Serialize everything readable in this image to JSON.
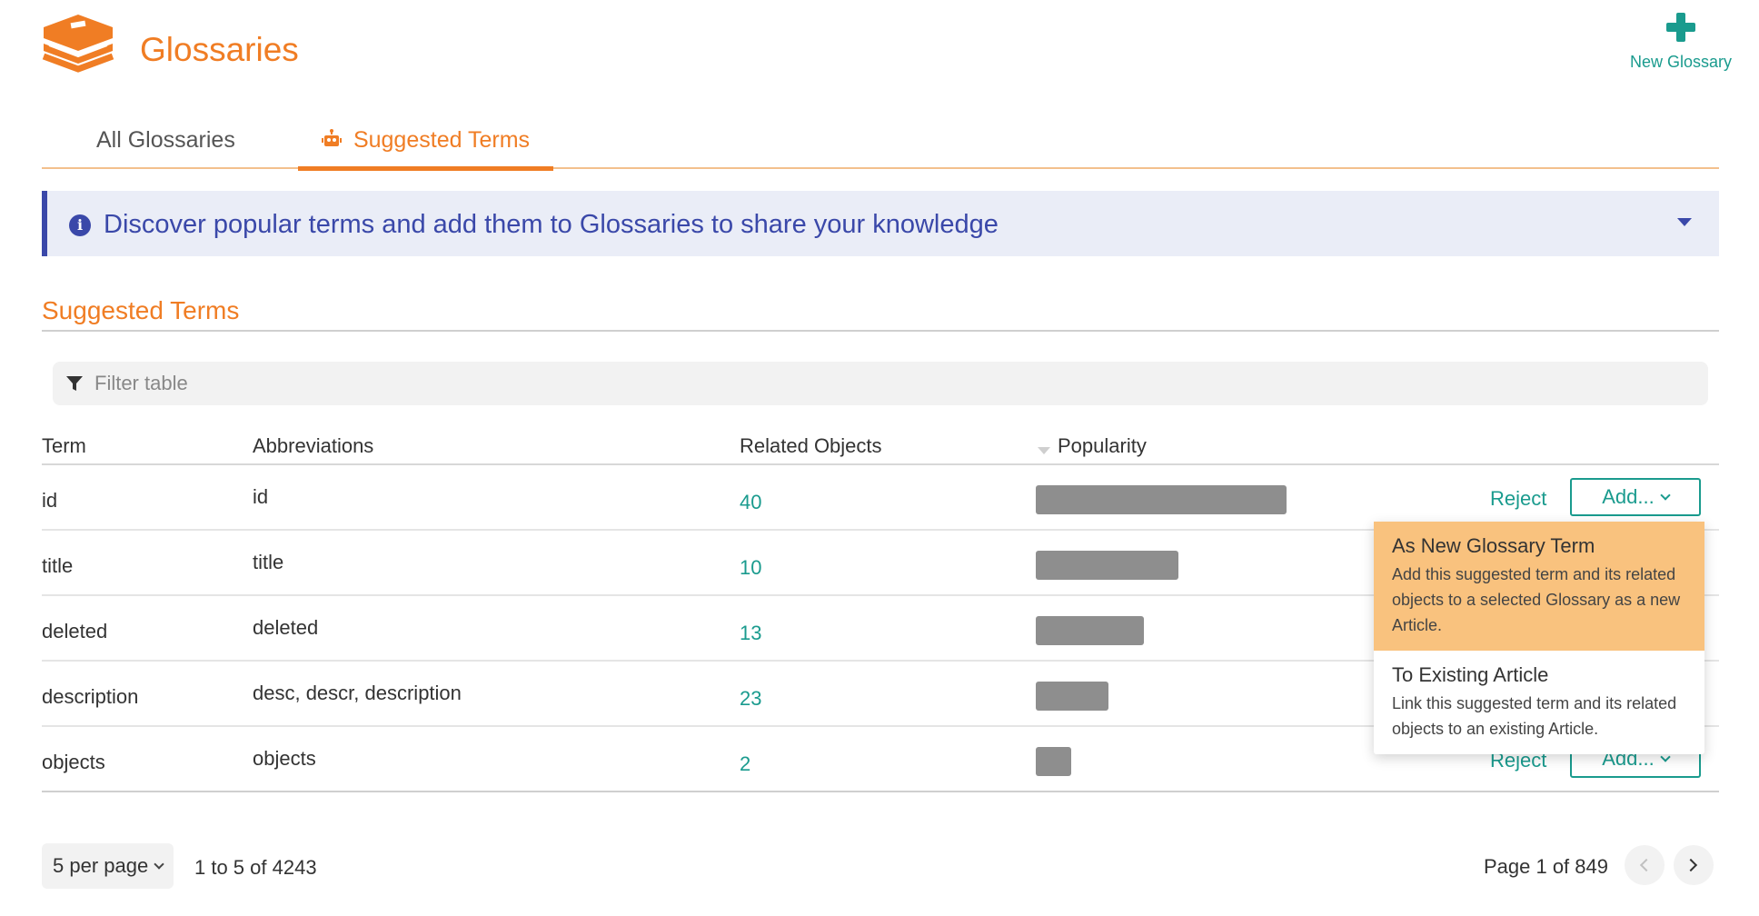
{
  "header": {
    "title": "Glossaries",
    "new_glossary_label": "New Glossary",
    "logo_icon": "books-icon",
    "accent_color": "#f07d24",
    "action_color": "#1a9b8e"
  },
  "tabs": [
    {
      "label": "All Glossaries",
      "active": false
    },
    {
      "label": "Suggested Terms",
      "active": true,
      "icon": "robot-icon"
    }
  ],
  "banner": {
    "message": "Discover popular terms and add them to Glossaries to share your knowledge",
    "icon": "info-icon",
    "color": "#3a48a9"
  },
  "section": {
    "title": "Suggested Terms"
  },
  "filter": {
    "placeholder": "Filter table",
    "value": ""
  },
  "table": {
    "columns": [
      "Term",
      "Abbreviations",
      "Related Objects",
      "Popularity"
    ],
    "sorted_by": "Popularity",
    "sort_direction": "descending",
    "reject_label": "Reject",
    "add_label": "Add...",
    "rows": [
      {
        "term": "id",
        "abbreviations": "id",
        "related_objects": "40",
        "popularity": 1.0
      },
      {
        "term": "title",
        "abbreviations": "title",
        "related_objects": "10",
        "popularity": 0.57
      },
      {
        "term": "deleted",
        "abbreviations": "deleted",
        "related_objects": "13",
        "popularity": 0.43
      },
      {
        "term": "description",
        "abbreviations": "desc, descr, description",
        "related_objects": "23",
        "popularity": 0.29
      },
      {
        "term": "objects",
        "abbreviations": "objects",
        "related_objects": "2",
        "popularity": 0.14
      }
    ]
  },
  "add_menu": {
    "items": [
      {
        "title": "As New Glossary Term",
        "description": "Add this suggested term and its related objects to a selected Glossary as a new Article.",
        "highlighted": true
      },
      {
        "title": "To Existing Article",
        "description": "Link this suggested term and its related objects to an existing Article.",
        "highlighted": false
      }
    ]
  },
  "pagination": {
    "per_page_label": "5 per page",
    "range_label": "1 to 5 of 4243",
    "page_label": "Page 1 of 849"
  }
}
